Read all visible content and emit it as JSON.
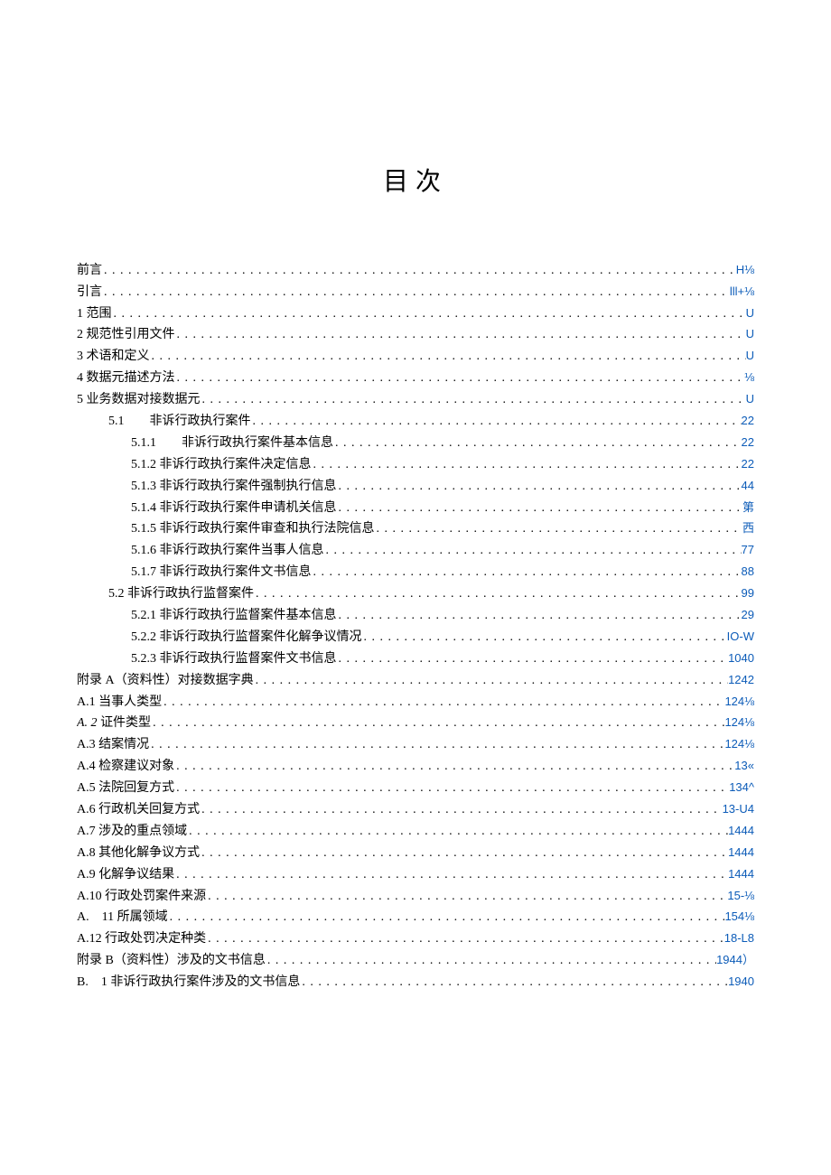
{
  "title": "目次",
  "toc": [
    {
      "label": "前言",
      "page": "H⅛",
      "indent": 0
    },
    {
      "label": "引言",
      "page": "lll+⅛",
      "indent": 0
    },
    {
      "label": "1 范围",
      "page": "U",
      "indent": 0
    },
    {
      "label": "2 规范性引用文件",
      "page": "U",
      "indent": 0
    },
    {
      "label": "3 术语和定义",
      "page": "U",
      "indent": 0
    },
    {
      "label": "4 数据元描述方法",
      "page": "⅛",
      "indent": 0
    },
    {
      "label": "5 业务数据对接数据元",
      "page": "U",
      "indent": 0
    },
    {
      "label": "5.1　　非诉行政执行案件",
      "page": "22",
      "indent": 1
    },
    {
      "label": "5.1.1　　非诉行政执行案件基本信息",
      "page": "22",
      "indent": 2
    },
    {
      "label": "5.1.2 非诉行政执行案件决定信息",
      "page": "22",
      "indent": 2
    },
    {
      "label": "5.1.3 非诉行政执行案件强制执行信息",
      "page": "44",
      "indent": 2
    },
    {
      "label": "5.1.4 非诉行政执行案件申请机关信息",
      "page": "第",
      "indent": 2
    },
    {
      "label": "5.1.5 非诉行政执行案件审查和执行法院信息",
      "page": "西",
      "indent": 2
    },
    {
      "label": "5.1.6 非诉行政执行案件当事人信息",
      "page": "77",
      "indent": 2
    },
    {
      "label": "5.1.7 非诉行政执行案件文书信息",
      "page": "88",
      "indent": 2
    },
    {
      "label": "5.2 非诉行政执行监督案件",
      "page": "99",
      "indent": 1
    },
    {
      "label": "5.2.1 非诉行政执行监督案件基本信息",
      "page": "29",
      "indent": 2
    },
    {
      "label": "5.2.2 非诉行政执行监督案件化解争议情况",
      "page": "IO-W",
      "indent": 2
    },
    {
      "label": "5.2.3 非诉行政执行监督案件文书信息",
      "page": "1040",
      "indent": 2
    },
    {
      "label": "附录 A（资料性）对接数据字典",
      "page": "1242",
      "indent": 0
    },
    {
      "label": "A.1 当事人类型",
      "page": "124⅛",
      "indent": 0
    },
    {
      "label_html": "<span class=\"italic\">A. 2</span> 证件类型",
      "label": "A. 2 证件类型",
      "page": "124⅛",
      "indent": 0
    },
    {
      "label": "A.3 结案情况",
      "page": "124⅛",
      "indent": 0
    },
    {
      "label": "A.4 检察建议对象",
      "page": "13«",
      "indent": 0
    },
    {
      "label": "A.5 法院回复方式",
      "page": "134^",
      "indent": 0
    },
    {
      "label": "A.6 行政机关回复方式",
      "page": "13-U4",
      "indent": 0
    },
    {
      "label": "A.7 涉及的重点领域",
      "page": "1444",
      "indent": 0
    },
    {
      "label": "A.8 其他化解争议方式",
      "page": "1444",
      "indent": 0
    },
    {
      "label": "A.9 化解争议结果",
      "page": "1444",
      "indent": 0
    },
    {
      "label": "A.10 行政处罚案件来源",
      "page": "15-⅛",
      "indent": 0
    },
    {
      "label": "A.　11 所属领域",
      "page": "154⅛",
      "indent": 0
    },
    {
      "label": "A.12 行政处罚决定种类",
      "page": "18-L8",
      "indent": 0
    },
    {
      "label": "附录 B（资料性）涉及的文书信息",
      "page": "1944）",
      "indent": 0
    },
    {
      "label": "B.　1 非诉行政执行案件涉及的文书信息",
      "page": "1940",
      "indent": 0
    }
  ]
}
